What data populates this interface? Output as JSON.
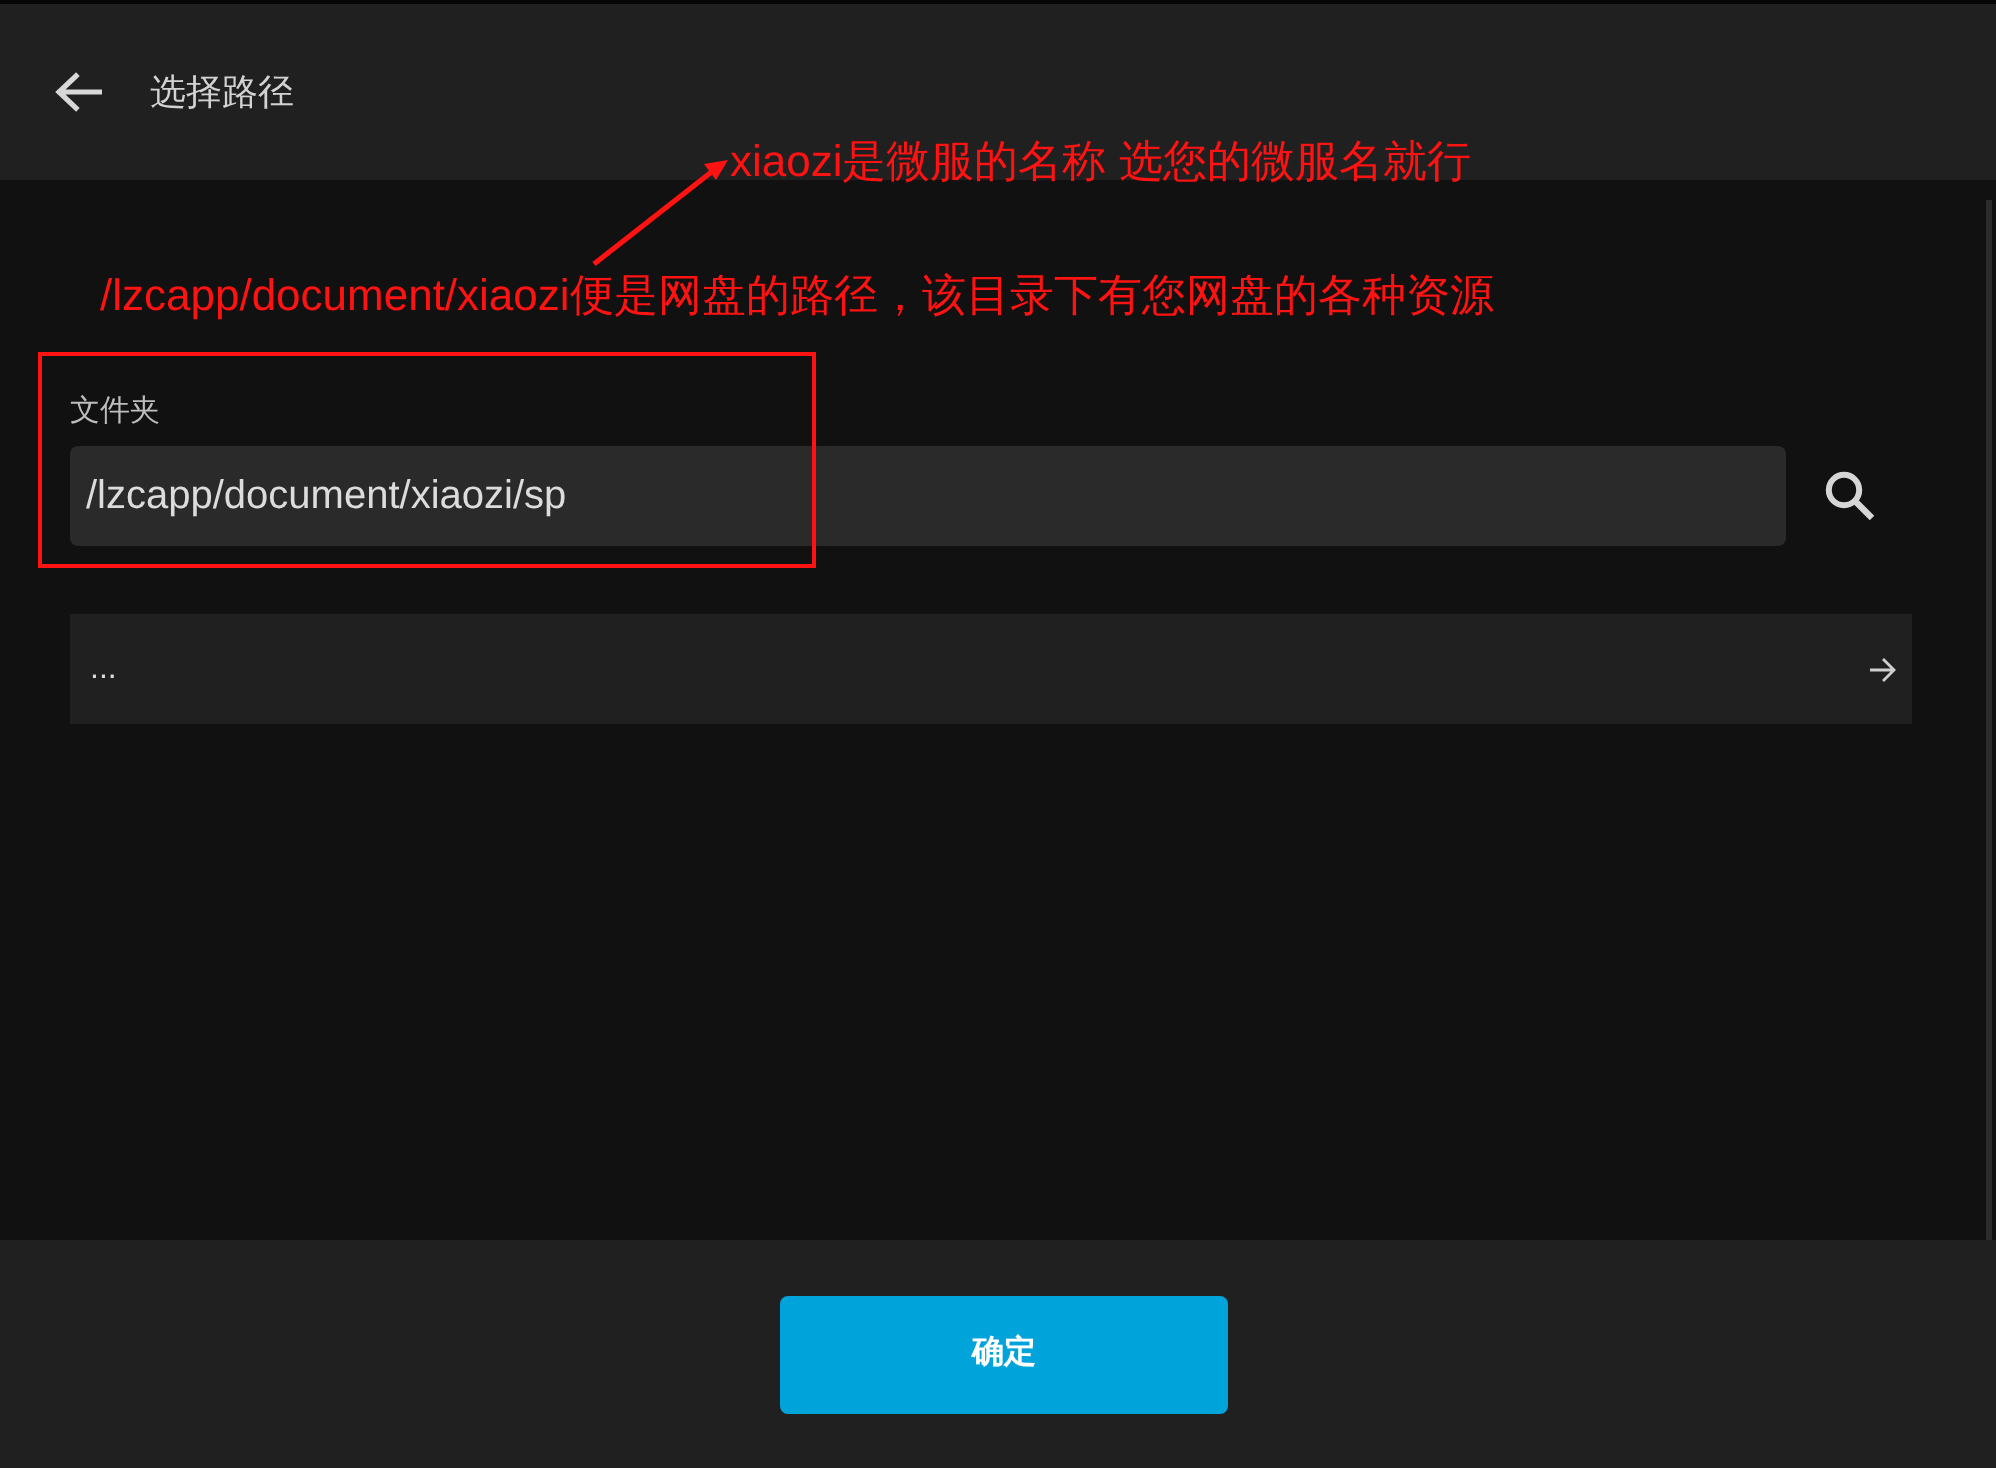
{
  "header": {
    "title": "选择路径"
  },
  "folder_field": {
    "label": "文件夹",
    "value": "/lzcapp/document/xiaozi/sp"
  },
  "entries": [
    {
      "label": "..."
    }
  ],
  "confirm_button": {
    "label": "确定"
  },
  "annotations": [
    {
      "kind": "arrow-note",
      "text": "xiaozi是微服的名称 选您的微服名就行"
    },
    {
      "kind": "note",
      "text": "/lzcapp/document/xiaozi便是网盘的路径，该目录下有您网盘的各种资源"
    },
    {
      "kind": "frame"
    }
  ]
}
